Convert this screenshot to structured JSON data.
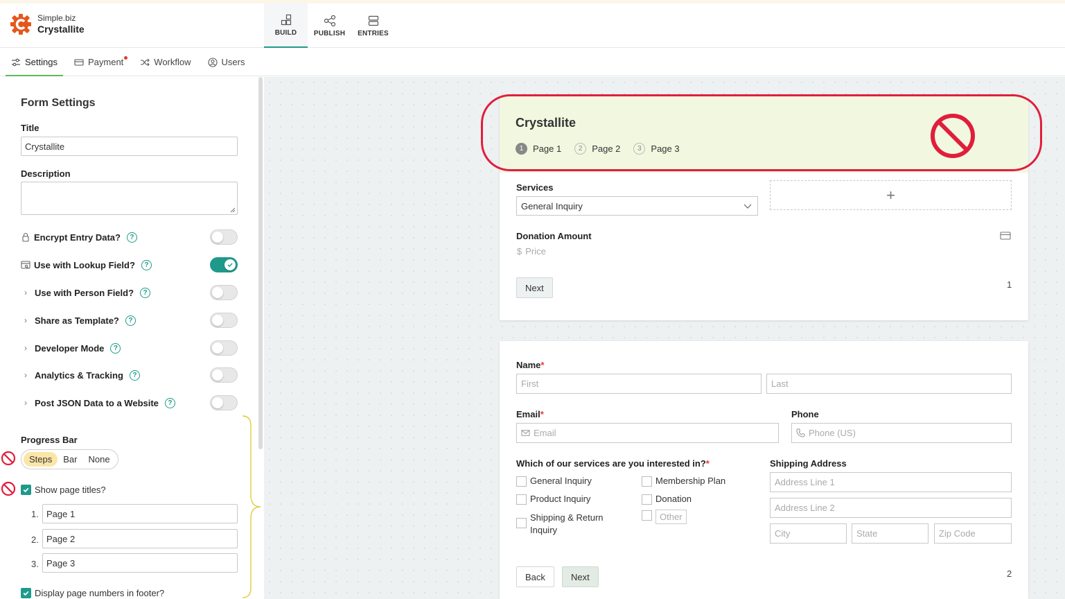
{
  "brand": {
    "company": "Simple.biz",
    "app_name": "Crystallite",
    "logo_icon": "gear-logo",
    "accent": "#e4571b"
  },
  "mode_tabs": [
    {
      "label": "BUILD",
      "icon": "blocks-icon",
      "active": true
    },
    {
      "label": "PUBLISH",
      "icon": "share-icon",
      "active": false
    },
    {
      "label": "ENTRIES",
      "icon": "rows-icon",
      "active": false
    }
  ],
  "subnav": [
    {
      "label": "Settings",
      "icon": "sliders-icon",
      "active": true
    },
    {
      "label": "Payment",
      "icon": "card-icon",
      "badge": true
    },
    {
      "label": "Workflow",
      "icon": "shuffle-icon"
    },
    {
      "label": "Users",
      "icon": "user-icon"
    }
  ],
  "settings": {
    "panel_title": "Form Settings",
    "title_label": "Title",
    "title_value": "Crystallite",
    "description_label": "Description",
    "description_value": "",
    "toggles": [
      {
        "label": "Encrypt Entry Data?",
        "icon": "lock-icon",
        "on": false
      },
      {
        "label": "Use with Lookup Field?",
        "icon": "lookup-icon",
        "on": true
      },
      {
        "label": "Use with Person Field?",
        "icon": "chevron-right-icon",
        "on": false
      },
      {
        "label": "Share as Template?",
        "icon": "chevron-right-icon",
        "on": false
      },
      {
        "label": "Developer Mode",
        "icon": "chevron-right-icon",
        "on": false
      },
      {
        "label": "Analytics & Tracking",
        "icon": "chevron-right-icon",
        "on": false
      },
      {
        "label": "Post JSON Data to a Website",
        "icon": "chevron-right-icon",
        "on": false
      }
    ],
    "progress_bar_label": "Progress Bar",
    "progress_options": [
      "Steps",
      "Bar",
      "None"
    ],
    "progress_selected": "Steps",
    "show_page_titles_label": "Show page titles?",
    "show_page_titles_checked": true,
    "page_titles": [
      {
        "num": "1.",
        "value": "Page 1"
      },
      {
        "num": "2.",
        "value": "Page 2"
      },
      {
        "num": "3.",
        "value": "Page 3"
      }
    ],
    "footer_numbers_label": "Display page numbers in footer?",
    "footer_numbers_checked": true
  },
  "form": {
    "title": "Crystallite",
    "steps": [
      {
        "num": "1",
        "label": "Page 1",
        "active": true
      },
      {
        "num": "2",
        "label": "Page 2",
        "active": false
      },
      {
        "num": "3",
        "label": "Page 3",
        "active": false
      }
    ],
    "page1": {
      "services_label": "Services",
      "services_value": "General Inquiry",
      "add_symbol": "+",
      "donation_label": "Donation Amount",
      "price_placeholder": "Price",
      "next": "Next",
      "page_number": "1"
    },
    "page2": {
      "name_label": "Name",
      "required_mark": "*",
      "first_placeholder": "First",
      "last_placeholder": "Last",
      "email_label": "Email",
      "email_placeholder": "Email",
      "phone_label": "Phone",
      "phone_placeholder": "Phone (US)",
      "services_question": "Which of our services are you interested in?",
      "options_col1": [
        "General Inquiry",
        "Product Inquiry",
        "Shipping & Return Inquiry"
      ],
      "options_col2": [
        "Membership Plan",
        "Donation"
      ],
      "other_placeholder": "Other",
      "shipping_label": "Shipping Address",
      "address1_placeholder": "Address Line 1",
      "address2_placeholder": "Address Line 2",
      "city_placeholder": "City",
      "state_placeholder": "State",
      "zip_placeholder": "Zip Code",
      "back": "Back",
      "next": "Next",
      "page_number": "2"
    }
  },
  "colors": {
    "teal": "#1f9a8a",
    "annotation_red": "#e01e3c",
    "header_green": "#f2f7e0",
    "brace_yellow": "#e2cc3a"
  }
}
